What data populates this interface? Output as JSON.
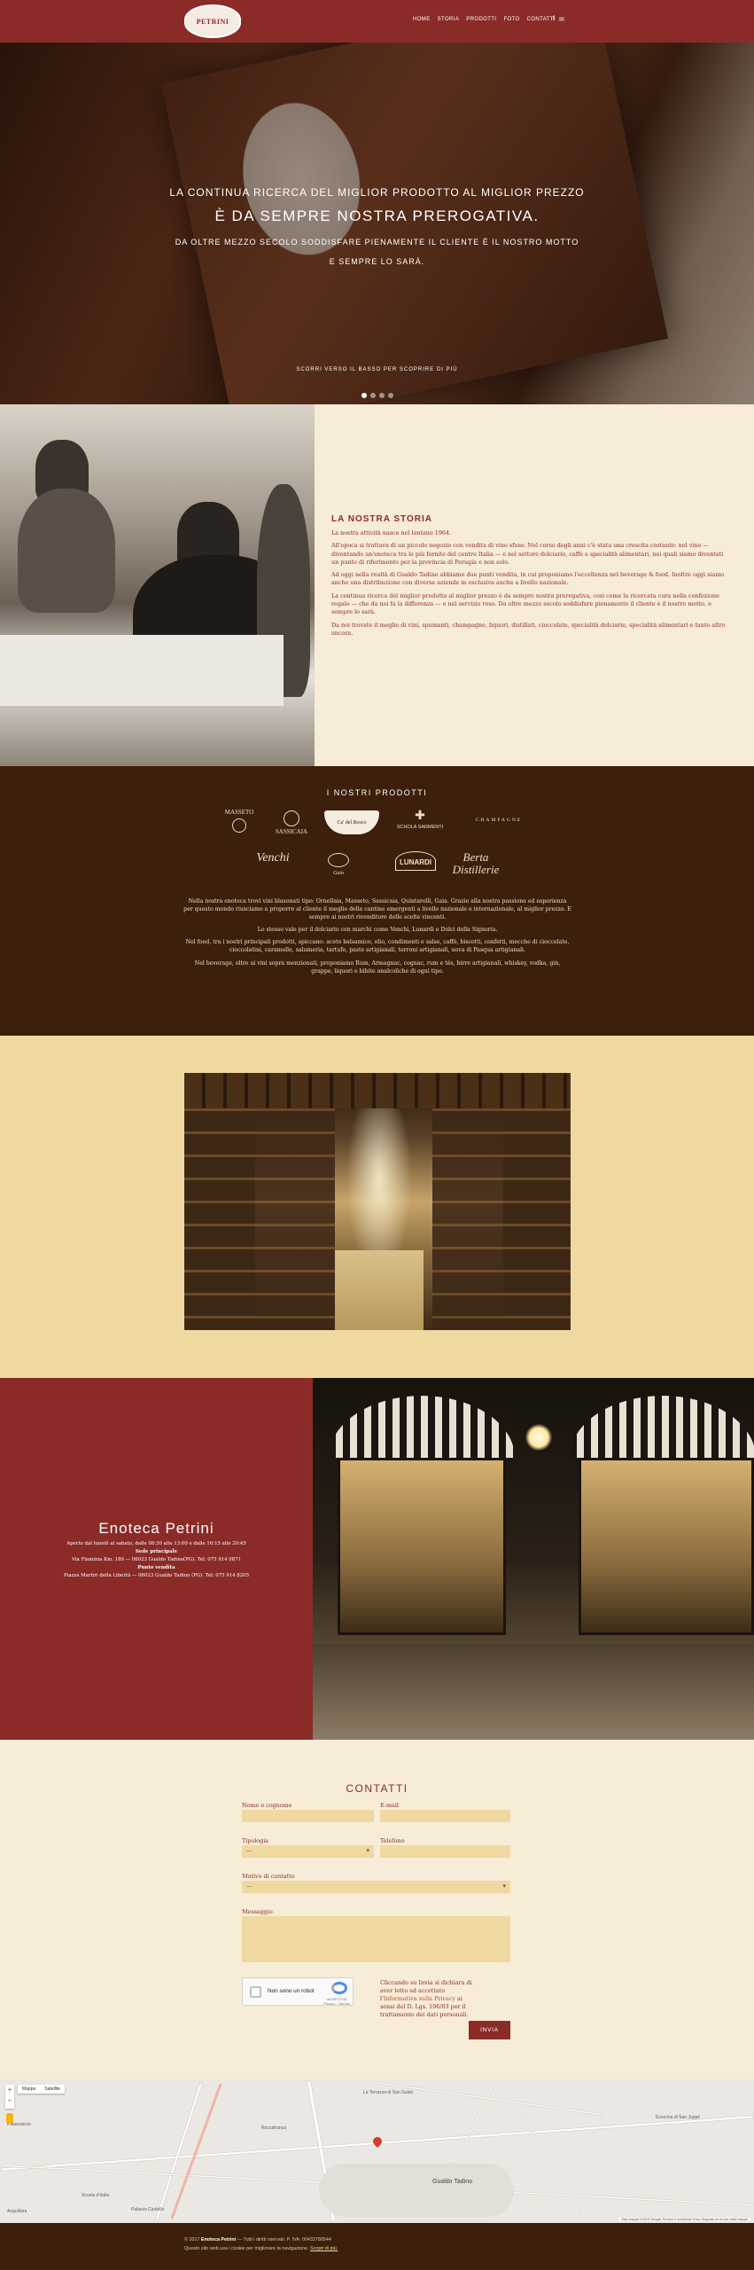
{
  "header": {
    "logo_text": "PETRINI",
    "nav": [
      "HOME",
      "STORIA",
      "PRODOTTI",
      "FOTO",
      "CONTATTI"
    ],
    "social_icons": [
      "facebook-icon",
      "mail-icon"
    ]
  },
  "hero": {
    "line1": "LA CONTINUA RICERCA DEL MIGLIOR PRODOTTO AL MIGLIOR PREZZO",
    "line2": "È DA SEMPRE NOSTRA PREROGATIVA.",
    "line3": "DA OLTRE MEZZO SECOLO SODDISFARE PIENAMENTE IL CLIENTE È IL NOSTRO MOTTO",
    "line4": "E SEMPRE LO SARÀ.",
    "scroll_hint": "SCORRI VERSO IL BASSO PER SCOPRIRE DI PIÙ",
    "slides": 4,
    "active_slide": 1
  },
  "story": {
    "title": "LA NOSTRA STORIA",
    "paragraphs": [
      "La nostra attività nasce nel lontano 1964.",
      "All'epoca si trattava di un piccolo negozio con vendita di vino sfuso. Nel corso degli anni c'è stata una crescita costante: nel vino — diventando un'enoteca tra le più fornite del centro Italia — e nel settore dolciario, caffè e specialità alimentari, nei quali siamo diventati un punto di riferimento per la provincia di Perugia e non solo.",
      "Ad oggi nella realtà di Gualdo Tadino abbiamo due punti vendita, in cui proponiamo l'eccellenza nel beverage & food. Inoltre oggi siamo anche una distribuzione con diverse aziende in esclusiva anche a livello nazionale.",
      "La continua ricerca del miglior prodotto al miglior prezzo è da sempre nostra prerogativa, così come la ricercata cura nella confezione regalo — che da noi fa la differenza — e nel servizio reso. Da oltre mezzo secolo soddisfare pienamente il cliente è il nostro motto, e sempre lo sarà.",
      "Da noi trovate il meglio di vini, spumanti, champagne, liquori, distillati, cioccolate, specialità dolciarie, specialità alimentari e tanto altro ancora."
    ]
  },
  "products": {
    "title": "I NOSTRI PRODOTTI",
    "brands_row1": [
      "MASSETO",
      "SASSICAIA",
      "Ca' del Bosco",
      "SCHOLA SARMENTI",
      "CHAMPAGNE"
    ],
    "brands_row2": [
      "Venchi",
      "Gaia",
      "LUNARDI",
      "Berta Distillerie"
    ],
    "paragraphs": [
      "Nella nostra enoteca trovi vini blasonati tipo: Ornellaia, Masseto, Sassicaia, Quintarelli, Gaia. Grazie alla nostra passione ed esperienza per questo mondo riusciamo a proporre al cliente il meglio delle cantine emergenti a livello nazionale e internazionale, al miglior prezzo. E sempre ai nostri rivenditore delle scelte vincenti.",
      "Lo stesso vale per il dolciario con marchi come Venchi, Lunardi e Dolci della Signoria.",
      "Nel food, tra i nostri principali prodotti, spiccano: aceto balsamico, olio, condimenti e salse, caffè, biscotti, confetti, mocche di cioccolato, cioccolatini, caramelle, salumeria, tartufo, paste artigianali, torroni artigianali, uova di Pasqua artigianali.",
      "Nel beverage, oltre ai vini sopra menzionati, proponiamo Rum, Armagnac, cognac, rum e tés, birre artigianali, whiskey, vodka, gin, grappe, liquori e bibite analcoliche di ogni tipo."
    ]
  },
  "gallery": {
    "dots": 18,
    "active_dot": 1
  },
  "shop": {
    "name": "Enoteca Petrini",
    "hours": "Aperto dal lunedì al sabato, dalle 08:30 alle 13:00 e dalle 16:15 alle 20:45",
    "main_label": "Sede principale",
    "main_address": "Via Flaminia Km. 189 — 06023 Gualdo Tadino(PG). Tel: 075 914 0871",
    "store_label": "Punto vendita",
    "store_address": "Piazza Martiri della Libertà — 06023 Gualdo Tadino (PG). Tel: 075 914 8205"
  },
  "contact": {
    "title": "CONTATTI",
    "name_label": "Nome e cognome",
    "email_label": "E-mail",
    "type_label": "Tipologia",
    "type_value": "—",
    "phone_label": "Telefono",
    "reason_label": "Motivo di contatto",
    "reason_value": "—",
    "message_label": "Messaggio",
    "captcha_text": "Non sono un robot",
    "captcha_brand": "reCAPTCHA Privacy - Termini",
    "consent_pre": "Cliccando su Invia si dichiara di aver letto ed accettato l'",
    "consent_link": "Informativa sulla Privacy",
    "consent_post": " ai sensi del D. Lgs. 196/03 per il trattamento dei dati personali.",
    "send_label": "INVIA"
  },
  "map": {
    "zoom_in": "+",
    "zoom_out": "−",
    "map_types": [
      "Mappa",
      "Satellite"
    ],
    "labels": [
      "Palazzaccio",
      "Anguillara",
      "Roccafranca",
      "La Terrazza di San Guido",
      "Ecozona di San Juppé",
      "Gualdo Tadino",
      "Scuola d'Italia",
      "Palazzo Castello"
    ],
    "attribution": "Dati mappa ©2019 Google   Termini e condizioni d'uso   Segnala un errore nella mappa"
  },
  "footer": {
    "line1_pre": "© 2017 ",
    "line1_brand": "Enoteca Petrini",
    "line1_post": " — Tutti i diritti riservati. P. IVA: 00433780544",
    "line2_pre": "Questo sito web usa i cookie per migliorare la navigazione. ",
    "line2_link": "Scopri di più."
  }
}
